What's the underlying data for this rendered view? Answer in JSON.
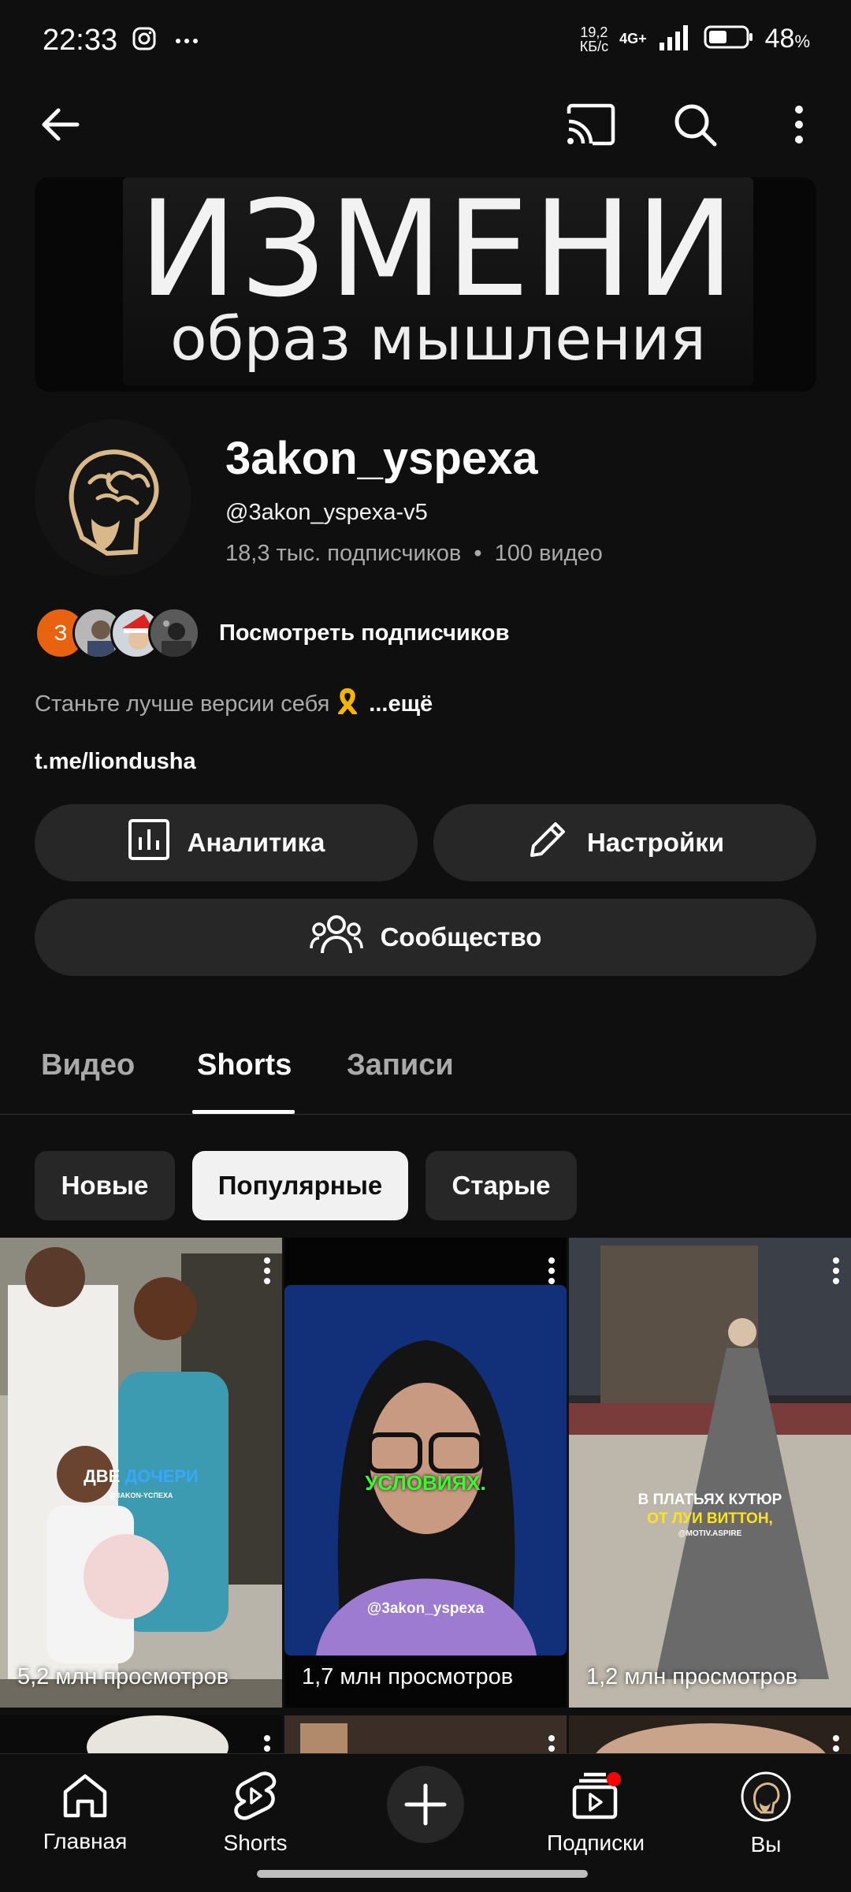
{
  "status": {
    "time": "22:33",
    "net_speed_top": "19,2",
    "net_speed_bottom": "КБ/с",
    "net_type": "4G+",
    "battery": "48",
    "battery_unit": "%"
  },
  "banner": {
    "line1": "ИЗМЕНИ",
    "line2": "образ мышления"
  },
  "channel": {
    "name": "3akon_yspexa",
    "handle": "@3akon_yspexa-v5",
    "subscribers": "18,3 тыс. подписчиков",
    "separator": "•",
    "videos": "100 видео",
    "subscriber_letter": "З",
    "view_subscribers": "Посмотреть подписчиков",
    "description": "Станьте лучше версии себя",
    "more": "...ещё",
    "link": "t.me/liondusha"
  },
  "actions": {
    "analytics": "Аналитика",
    "settings": "Настройки",
    "community": "Сообщество"
  },
  "tabs": [
    {
      "label": "Видео"
    },
    {
      "label": "Shorts"
    },
    {
      "label": "Записи"
    }
  ],
  "filters": [
    {
      "label": "Новые"
    },
    {
      "label": "Популярные"
    },
    {
      "label": "Старые"
    }
  ],
  "shorts": [
    {
      "views": "5,2 млн просмотров",
      "caption_a": "ДВЕ",
      "caption_b": "ДОЧЕРИ",
      "watermark": "@3AKON-YCПEXA"
    },
    {
      "views": "1,7 млн просмотров",
      "caption_a": "УСЛОВИЯХ.",
      "watermark": "@3akon_yspexa"
    },
    {
      "views": "1,2 млн просмотров",
      "caption_a": "В ПЛАТЬЯХ КУТЮР",
      "caption_b": "ОТ ЛУИ ВИТТОН,",
      "watermark": "@MOTIV.ASPIRE"
    }
  ],
  "nav": {
    "home": "Главная",
    "shorts": "Shorts",
    "subscriptions": "Подписки",
    "you": "Вы"
  },
  "colors": {
    "background": "#0f0f0f",
    "surface": "#272727",
    "accent_red": "#ff0000",
    "subscriber_orange": "#e8620f",
    "caption_green": "#35ff2e",
    "caption_yellow": "#ffe21f"
  }
}
